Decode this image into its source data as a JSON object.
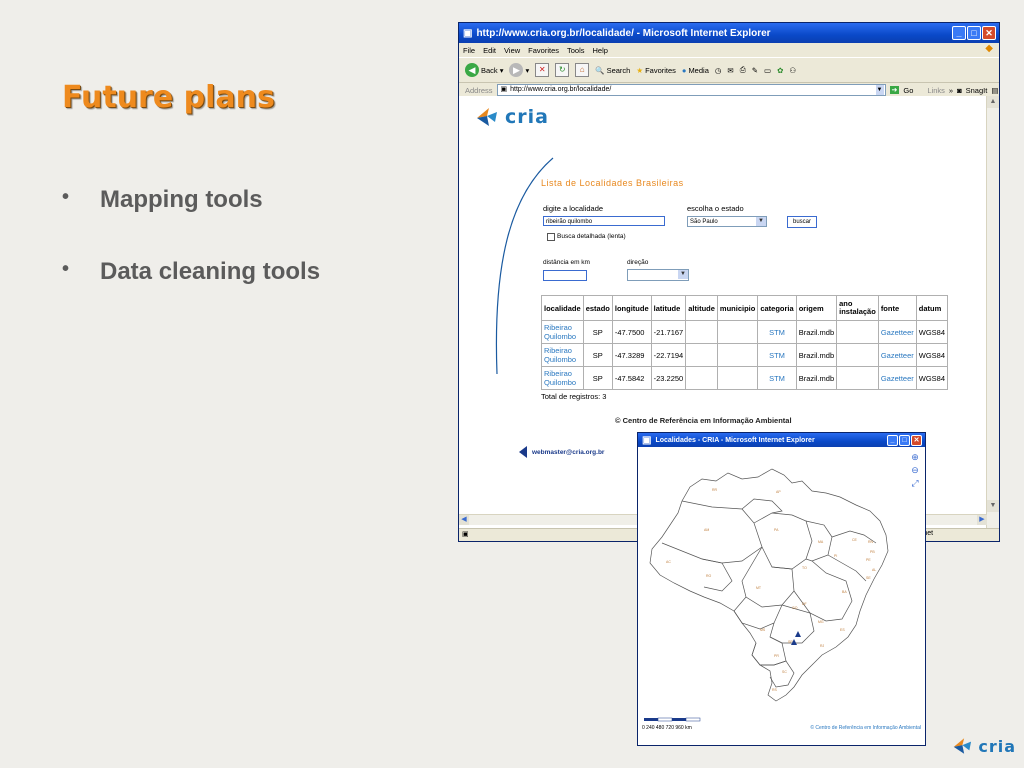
{
  "slide": {
    "title": "Future plans",
    "bullets": [
      "Mapping tools",
      "Data cleaning tools"
    ],
    "bullet_glyph": "•",
    "corner_logo_text": "cria"
  },
  "browser": {
    "title": "http://www.cria.org.br/localidade/ - Microsoft Internet Explorer",
    "menu": [
      "File",
      "Edit",
      "View",
      "Favorites",
      "Tools",
      "Help"
    ],
    "toolbar": {
      "back": "Back",
      "search": "Search",
      "favorites": "Favorites",
      "media": "Media"
    },
    "address_label": "Address",
    "address_value": "http://www.cria.org.br/localidade/",
    "go_label": "Go",
    "links_label": "Links",
    "snagit_label": "SnagIt",
    "status_text": "rnet"
  },
  "page": {
    "logo_text": "cria",
    "heading": "Lista de Localidades Brasileiras",
    "locality_label": "digite a localidade",
    "locality_value": "ribeirão quilombo",
    "state_label": "escolha o estado",
    "state_value": "São Paulo",
    "search_button": "buscar",
    "detailed_search_label": "Busca detalhada (lenta)",
    "distance_label": "distância em km",
    "direction_label": "direção",
    "table": {
      "headers": [
        "localidade",
        "estado",
        "longitude",
        "latitude",
        "altitude",
        "municipio",
        "categoria",
        "origem",
        "ano instalação",
        "fonte",
        "datum"
      ],
      "rows": [
        [
          "Ribeirao Quilombo",
          "SP",
          "-47.7500",
          "-21.7167",
          "",
          "",
          "STM",
          "Brazil.mdb",
          "",
          "Gazetteer",
          "WGS84"
        ],
        [
          "Ribeirao Quilombo",
          "SP",
          "-47.3289",
          "-22.7194",
          "",
          "",
          "STM",
          "Brazil.mdb",
          "",
          "Gazetteer",
          "WGS84"
        ],
        [
          "Ribeirao Quilombo",
          "SP",
          "-47.5842",
          "-23.2250",
          "",
          "",
          "STM",
          "Brazil.mdb",
          "",
          "Gazetteer",
          "WGS84"
        ]
      ]
    },
    "total": "Total de registros: 3",
    "copyright": "© Centro de Referência em Informação Ambiental",
    "webmaster": "webmaster@cria.org.br"
  },
  "map_window": {
    "title": "Localidades - CRIA - Microsoft Internet Explorer",
    "state_labels": [
      "RR",
      "AP",
      "AM",
      "PA",
      "MA",
      "CE",
      "RN",
      "PB",
      "PE",
      "AL",
      "SE",
      "PI",
      "AC",
      "RO",
      "TO",
      "BA",
      "MT",
      "GO",
      "DF",
      "MG",
      "ES",
      "MS",
      "SP",
      "RJ",
      "PR",
      "SC",
      "RS"
    ],
    "scale_text": "0   240  480  720  960  km",
    "copyright": "© Centro de Referência em Informação Ambiental"
  },
  "colors": {
    "title_orange": "#ee8a1e",
    "link_blue": "#2a78c0",
    "xp_blue": "#0a49c8"
  }
}
